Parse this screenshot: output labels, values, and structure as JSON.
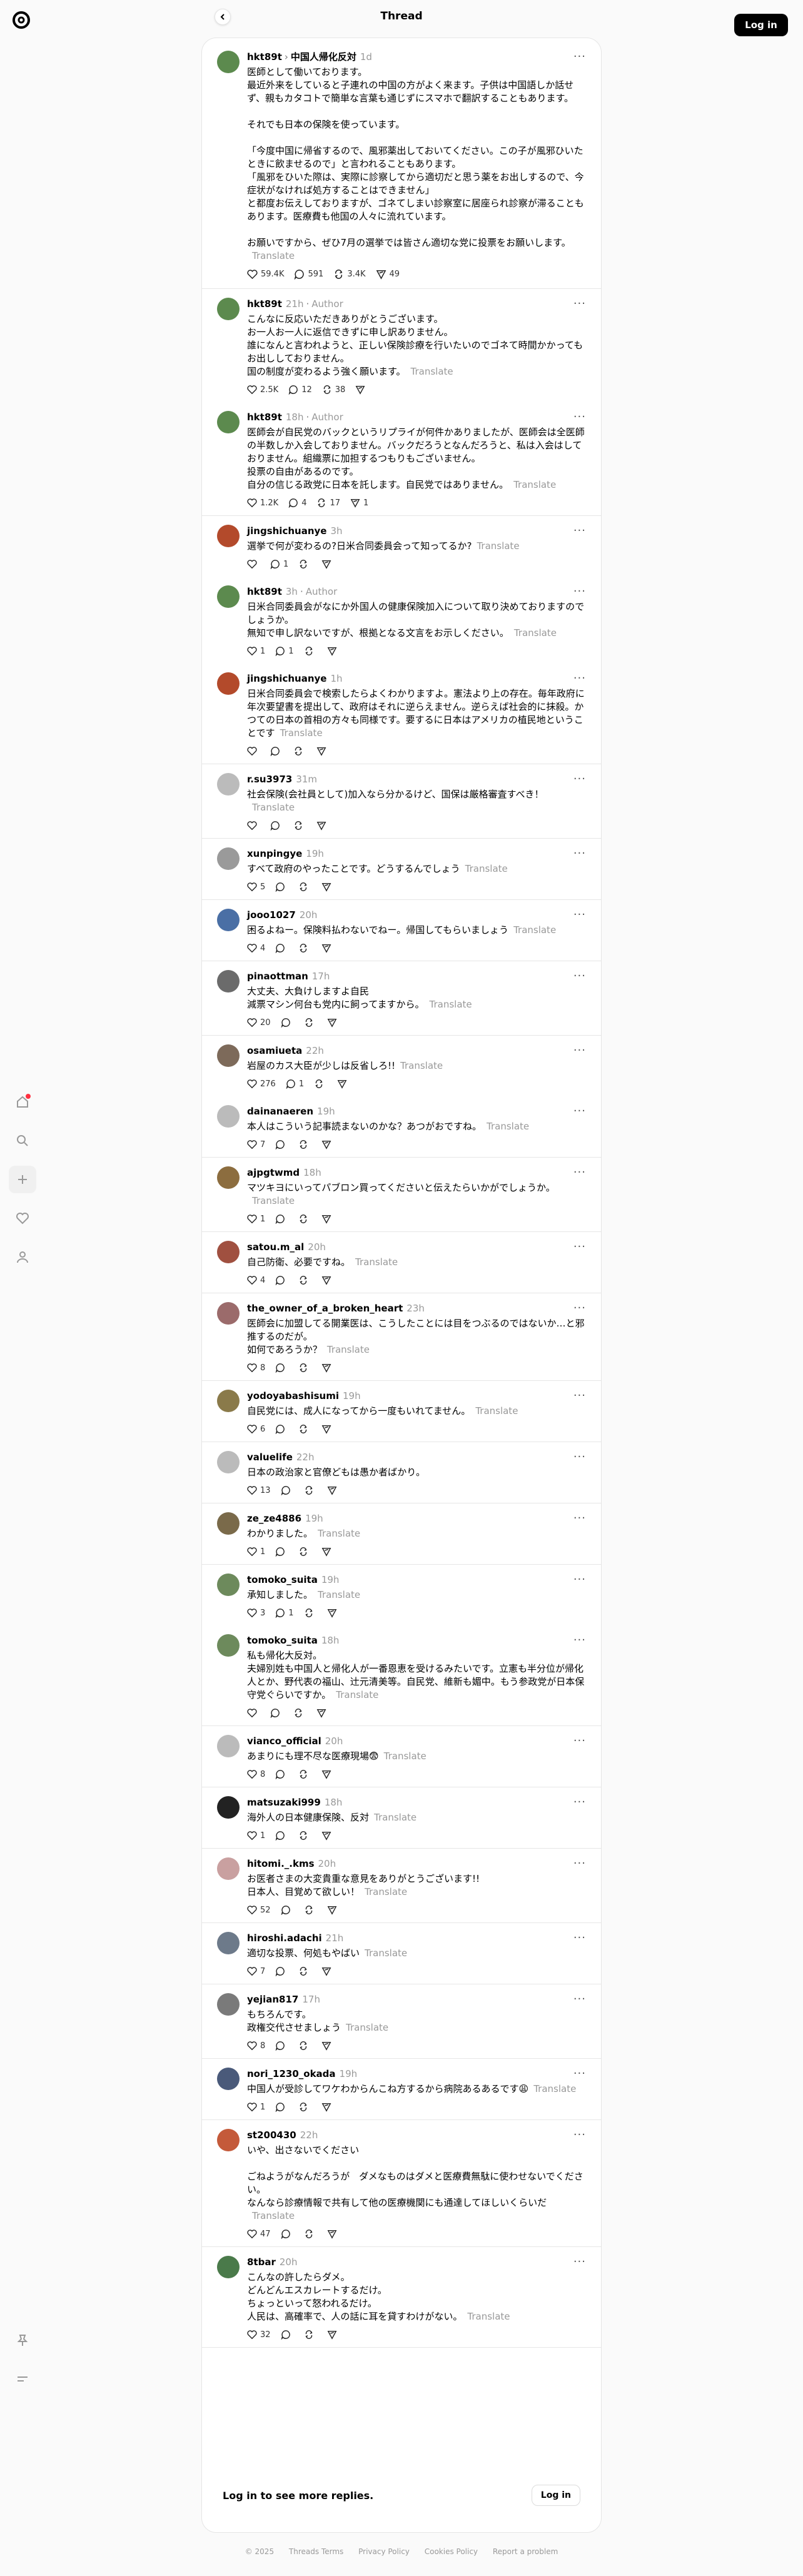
{
  "header": {
    "title": "Thread",
    "login_label": "Log in"
  },
  "accent": "#ff3040",
  "main_post": {
    "user": "hkt89t",
    "target": "中国人帰化反対",
    "time": "1d",
    "text": "医師として働いております。\n最近外来をしていると子連れの中国の方がよく来ます。子供は中国語しか話せず、親もカタコトで簡単な言葉も通じずにスマホで翻訳することもあります。\n\nそれでも日本の保険を使っています。\n\n「今度中国に帰省するので、風邪薬出しておいてください。この子が風邪ひいたときに飲ませるので」と言われることもあります。\n「風邪をひいた際は、実際に診察してから適切だと思う薬をお出しするので、今症状がなければ処方することはできません」\nと都度お伝えしておりますが、ゴネてしまい診察室に居座られ診察が滞ることもあります。医療費も他国の人々に流れています。\n\nお願いですから、ぜひ7月の選挙では皆さん適切な党に投票をお願いします。",
    "translate": "Translate",
    "likes": "59.4K",
    "comments": "591",
    "reposts": "3.4K",
    "shares": "49"
  },
  "replies": [
    {
      "user": "hkt89t",
      "badge": "Author",
      "time": "21h",
      "text": "こんなに反応いただきありがとうございます。\nお一人お一人に返信できずに申し訳ありません。\n誰になんと言われようと、正しい保険診療を行いたいのでゴネて時間かかってもお出ししておりません。\n国の制度が変わるよう強く願います。",
      "translate": "Translate",
      "likes": "2.5K",
      "comments": "12",
      "reposts": "38",
      "shares": ""
    },
    {
      "user": "hkt89t",
      "badge": "Author",
      "time": "18h",
      "text": "医師会が自民党のバックというリプライが何件かありましたが、医師会は全医師の半数しか入会しておりません。バックだろうとなんだろうと、私は入会はしておりません。組織票に加担するつもりもございません。\n投票の自由があるのです。\n自分の信じる政党に日本を託します。自民党ではありません。",
      "translate": "Translate",
      "likes": "1.2K",
      "comments": "4",
      "reposts": "17",
      "shares": "1"
    },
    {
      "user": "jingshichuanye",
      "badge": "",
      "time": "3h",
      "text": "選挙で何が変わるの?日米合同委員会って知ってるか?",
      "translate": "Translate",
      "likes": "",
      "comments": "1",
      "reposts": "",
      "shares": ""
    },
    {
      "user": "hkt89t",
      "badge": "Author",
      "time": "3h",
      "text": "日米合同委員会がなにか外国人の健康保険加入について取り決めておりますのでしょうか。\n無知で申し訳ないですが、根拠となる文言をお示しください。",
      "translate": "Translate",
      "likes": "1",
      "comments": "1",
      "reposts": "",
      "shares": ""
    },
    {
      "user": "jingshichuanye",
      "badge": "",
      "time": "1h",
      "text": "日米合同委員会で検索したらよくわかりますよ。憲法より上の存在。毎年政府に年次要望書を提出して、政府はそれに逆らえません。逆らえば社会的に抹殺。かつての日本の首相の方々も同様です。要するに日本はアメリカの植民地ということです",
      "translate": "Translate",
      "likes": "",
      "comments": "",
      "reposts": "",
      "shares": ""
    },
    {
      "user": "r.su3973",
      "badge": "",
      "time": "31m",
      "text": "社会保険(会社員として)加入なら分かるけど、国保は厳格審査すべき！",
      "translate": "Translate",
      "likes": "",
      "comments": "",
      "reposts": "",
      "shares": ""
    },
    {
      "user": "xunpingye",
      "badge": "",
      "time": "19h",
      "text": "すべて政府のやったことです。どうするんでしょう",
      "translate": "Translate",
      "likes": "5",
      "comments": "",
      "reposts": "",
      "shares": ""
    },
    {
      "user": "jooo1027",
      "badge": "",
      "time": "20h",
      "text": "困るよねー。保険料払わないでねー。帰国してもらいましょう",
      "translate": "Translate",
      "likes": "4",
      "comments": "",
      "reposts": "",
      "shares": ""
    },
    {
      "user": "pinaottman",
      "badge": "",
      "time": "17h",
      "text": "大丈夫、大負けしますよ自民\n減票マシン何台も党内に飼ってますから。",
      "translate": "Translate",
      "likes": "20",
      "comments": "",
      "reposts": "",
      "shares": ""
    },
    {
      "user": "osamiueta",
      "badge": "",
      "time": "22h",
      "text": "岩屋のカス大臣が少しは反省しろ!!",
      "translate": "Translate",
      "likes": "276",
      "comments": "1",
      "reposts": "",
      "shares": ""
    },
    {
      "user": "dainanaeren",
      "badge": "",
      "time": "19h",
      "text": "本人はこういう記事読まないのかな？あつがおですね。",
      "translate": "Translate",
      "likes": "7",
      "comments": "",
      "reposts": "",
      "shares": ""
    },
    {
      "user": "ajpgtwmd",
      "badge": "",
      "time": "18h",
      "text": "マツキヨにいってパブロン買ってくださいと伝えたらいかがでしょうか。",
      "translate": "Translate",
      "likes": "1",
      "comments": "",
      "reposts": "",
      "shares": ""
    },
    {
      "user": "satou.m_al",
      "badge": "",
      "time": "20h",
      "text": "自己防衛、必要ですね。",
      "translate": "Translate",
      "likes": "4",
      "comments": "",
      "reposts": "",
      "shares": ""
    },
    {
      "user": "the_owner_of_a_broken_heart",
      "badge": "",
      "time": "23h",
      "text": "医師会に加盟してる開業医は、こうしたことには目をつぶるのではないか…と邪推するのだが。\n如何であろうか？",
      "translate": "Translate",
      "likes": "8",
      "comments": "",
      "reposts": "",
      "shares": ""
    },
    {
      "user": "yodoyabashisumi",
      "badge": "",
      "time": "19h",
      "text": "自民党には、成人になってから一度もいれてません。",
      "translate": "Translate",
      "likes": "6",
      "comments": "",
      "reposts": "",
      "shares": ""
    },
    {
      "user": "valuelife",
      "badge": "",
      "time": "22h",
      "text": "日本の政治家と官僚どもは愚か者ばかり。",
      "translate": "",
      "likes": "13",
      "comments": "",
      "reposts": "",
      "shares": ""
    },
    {
      "user": "ze_ze4886",
      "badge": "",
      "time": "19h",
      "text": "わかりました。",
      "translate": "Translate",
      "likes": "1",
      "comments": "",
      "reposts": "",
      "shares": ""
    },
    {
      "user": "tomoko_suita",
      "badge": "",
      "time": "19h",
      "text": "承知しました。",
      "translate": "Translate",
      "likes": "3",
      "comments": "1",
      "reposts": "",
      "shares": ""
    },
    {
      "user": "tomoko_suita",
      "badge": "",
      "time": "18h",
      "text": "私も帰化大反対。\n夫婦別姓も中国人と帰化人が一番恩恵を受けるみたいです。立憲も半分位が帰化人とか、野代表の福山、辻元清美等。自民党、維新も媚中。もう参政党が日本保守党ぐらいですか。",
      "translate": "Translate",
      "likes": "",
      "comments": "",
      "reposts": "",
      "shares": ""
    },
    {
      "user": "vianco_official",
      "badge": "",
      "time": "20h",
      "text": "あまりにも理不尽な医療現場😨",
      "translate": "Translate",
      "likes": "8",
      "comments": "",
      "reposts": "",
      "shares": ""
    },
    {
      "user": "matsuzaki999",
      "badge": "",
      "time": "18h",
      "text": "海外人の日本健康保険、反対",
      "translate": "Translate",
      "likes": "1",
      "comments": "",
      "reposts": "",
      "shares": ""
    },
    {
      "user": "hitomi._.kms",
      "badge": "",
      "time": "20h",
      "text": "お医者さまの大変貴重な意見をありがとうございます!!\n日本人、目覚めて欲しい！",
      "translate": "Translate",
      "likes": "52",
      "comments": "",
      "reposts": "",
      "shares": ""
    },
    {
      "user": "hiroshi.adachi",
      "badge": "",
      "time": "21h",
      "text": "適切な投票、何処もやばい",
      "translate": "Translate",
      "likes": "7",
      "comments": "",
      "reposts": "",
      "shares": ""
    },
    {
      "user": "yejian817",
      "badge": "",
      "time": "17h",
      "text": "もちろんです。\n政権交代させましょう",
      "translate": "Translate",
      "likes": "8",
      "comments": "",
      "reposts": "",
      "shares": ""
    },
    {
      "user": "nori_1230_okada",
      "badge": "",
      "time": "19h",
      "text": "中国人が受診してワケわからんこね方するから病院あるあるです😩",
      "translate": "Translate",
      "likes": "1",
      "comments": "",
      "reposts": "",
      "shares": ""
    },
    {
      "user": "st200430",
      "badge": "",
      "time": "22h",
      "text": "いや、出さないでください\n\nごねようがなんだろうが　ダメなものはダメと医療費無駄に使わせないでください。\nなんなら診療情報で共有して他の医療機関にも通達してほしいくらいだ",
      "translate": "Translate",
      "likes": "47",
      "comments": "",
      "reposts": "",
      "shares": ""
    },
    {
      "user": "8tbar",
      "badge": "",
      "time": "20h",
      "text": "こんなの許したらダメ。\nどんどんエスカレートするだけ。\nちょっといって怒われるだけ。\n人民は、高確率で、人の話に耳を貸すわけがない。",
      "translate": "Translate",
      "likes": "32",
      "comments": "",
      "reposts": "",
      "shares": ""
    }
  ],
  "login_prompt": {
    "label": "Log in to see more replies.",
    "button": "Log in"
  },
  "footer": {
    "copyright": "© 2025",
    "links": [
      "Threads Terms",
      "Privacy Policy",
      "Cookies Policy",
      "Report a problem"
    ]
  }
}
